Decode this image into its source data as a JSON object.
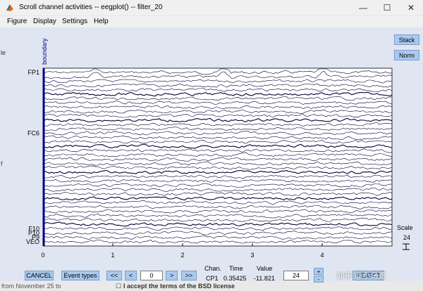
{
  "window": {
    "title": "Scroll channel activities -- eegplot() -- filter_20",
    "controls": [
      "—",
      "☐",
      "✕"
    ]
  },
  "menu": [
    "Figure",
    "Display",
    "Settings",
    "Help"
  ],
  "side_buttons": {
    "stack": "Stack",
    "norm": "Norm"
  },
  "scale": {
    "label": "Scale",
    "value": "24"
  },
  "boundary_label": "boundary",
  "channel_labels_visible": [
    "FP1",
    "FC6",
    "F10",
    "P10",
    "P9",
    "VEO"
  ],
  "bottom": {
    "cancel": "CANCEL",
    "event_types": "Event types",
    "nav_left2": "<<",
    "nav_left1": "<",
    "position_value": "0",
    "nav_right1": ">",
    "nav_right2": ">>",
    "chan_header": "Chan.",
    "time_header": "Time",
    "value_header": "Value",
    "chan_value": "CP1",
    "time_value": "0.35425",
    "value_value": "-11.821",
    "scale_field": "24",
    "plus": "+",
    "minus": "-",
    "reject": "REJECT"
  },
  "background_page": {
    "left_text_1": "le",
    "left_text_2": "f",
    "bottom_left_text": "from November 25 to",
    "bottom_right_text": "I accept the terms of the BSD license"
  },
  "watermark": "知乎 @小马哥",
  "chart_data": {
    "type": "line",
    "x_ticks": [
      "0",
      "1",
      "2",
      "3",
      "4"
    ],
    "xlim": [
      0,
      5
    ],
    "channel_count": 40,
    "boundary_event_time": 0,
    "colors": {
      "trace": "#000033",
      "boundary": "#00008b",
      "axes_bg": "#ffffff"
    }
  }
}
